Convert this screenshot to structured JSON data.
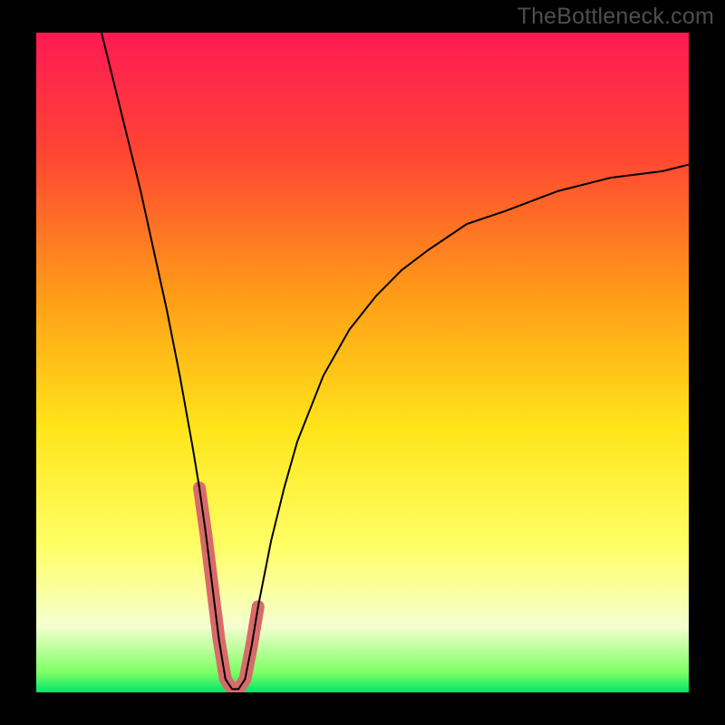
{
  "watermark": "TheBottleneck.com",
  "chart_data": {
    "type": "line",
    "title": "",
    "xlabel": "",
    "ylabel": "",
    "xlim": [
      0,
      100
    ],
    "ylim": [
      0,
      100
    ],
    "gradient_stops": [
      {
        "offset": 0.0,
        "color": "#ff1a53"
      },
      {
        "offset": 0.18,
        "color": "#ff4433"
      },
      {
        "offset": 0.4,
        "color": "#ff9d17"
      },
      {
        "offset": 0.6,
        "color": "#ffe51a"
      },
      {
        "offset": 0.78,
        "color": "#ffff66"
      },
      {
        "offset": 0.9,
        "color": "#f5ffd0"
      },
      {
        "offset": 0.97,
        "color": "#7dff64"
      },
      {
        "offset": 1.0,
        "color": "#00e46a"
      }
    ],
    "series": [
      {
        "name": "bottleneck-curve",
        "stroke": "#000000",
        "stroke_width": 2,
        "x": [
          10,
          12,
          14,
          16,
          18,
          20,
          22,
          24,
          25,
          26,
          27,
          28,
          29,
          30,
          31,
          32,
          33,
          34,
          36,
          38,
          40,
          44,
          48,
          52,
          56,
          60,
          66,
          72,
          80,
          88,
          96,
          100
        ],
        "y": [
          100,
          92,
          84,
          76,
          67,
          58,
          48,
          37,
          31,
          24,
          16,
          8,
          2,
          0.5,
          0.5,
          2,
          7,
          13,
          23,
          31,
          38,
          48,
          55,
          60,
          64,
          67,
          71,
          73,
          76,
          78,
          79,
          80
        ]
      },
      {
        "name": "highlight-band",
        "stroke": "#d96a6a",
        "stroke_width": 14,
        "linecap": "round",
        "x": [
          25,
          26,
          27,
          28,
          29,
          30,
          31,
          32,
          33,
          34
        ],
        "y": [
          31,
          24,
          16,
          8,
          2,
          0.5,
          0.5,
          2,
          7,
          13
        ]
      }
    ]
  }
}
